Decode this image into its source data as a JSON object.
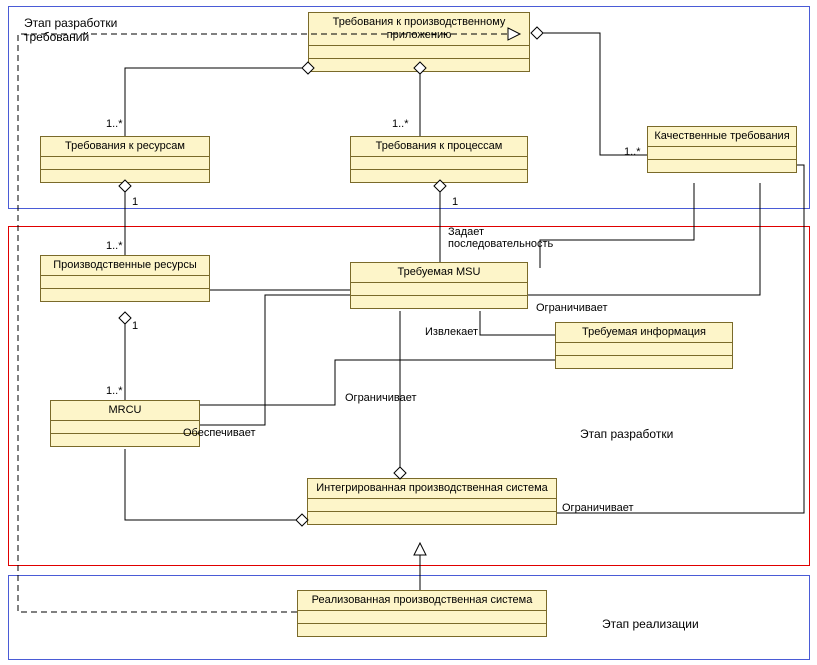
{
  "stages": {
    "requirements": {
      "label": "Этап разработки\nтребований"
    },
    "design": {
      "label": "Этап разработки"
    },
    "impl": {
      "label": "Этап реализации"
    }
  },
  "classes": {
    "appReq": {
      "title": "Требования к производственному\nприложению"
    },
    "resReq": {
      "title": "Требования к ресурсам"
    },
    "procReq": {
      "title": "Требования к процессам"
    },
    "qualReq": {
      "title": "Качественные\nтребования"
    },
    "prodRes": {
      "title": "Производственные\nресурсы"
    },
    "reqMSU": {
      "title": "Требуемая MSU"
    },
    "reqInfo": {
      "title": "Требуемая информация"
    },
    "mrcu": {
      "title": "MRCU"
    },
    "intSys": {
      "title": "Интегрированная производственная\nсистема"
    },
    "realSys": {
      "title": "Реализованная производственная\nсистема"
    }
  },
  "edges": {
    "m_resReq": "1..*",
    "m_procReq": "1..*",
    "m_qualReq": "1..*",
    "m_prodRes_top": "1",
    "m_prodRes_mid": "1..*",
    "m_procReq_bot": "1",
    "m_mrcu_top": "1",
    "m_mrcu_mid": "1..*",
    "seq": "Задает\nпоследовательность",
    "constrain1": "Ограничивает",
    "constrain2": "Ограничивает",
    "constrain3": "Ограничивает",
    "extract": "Извлекает",
    "provide": "Обеспечивает"
  },
  "chart_data": {
    "type": "uml-class-diagram",
    "packages": [
      {
        "id": "requirements",
        "label": "Этап разработки требований",
        "members": [
          "appReq",
          "resReq",
          "procReq",
          "qualReq"
        ]
      },
      {
        "id": "design",
        "label": "Этап разработки",
        "members": [
          "prodRes",
          "reqMSU",
          "reqInfo",
          "mrcu",
          "intSys"
        ]
      },
      {
        "id": "impl",
        "label": "Этап реализации",
        "members": [
          "realSys"
        ]
      }
    ],
    "classes": [
      {
        "id": "appReq",
        "name": "Требования к производственному приложению"
      },
      {
        "id": "resReq",
        "name": "Требования к ресурсам"
      },
      {
        "id": "procReq",
        "name": "Требования к процессам"
      },
      {
        "id": "qualReq",
        "name": "Качественные требования"
      },
      {
        "id": "prodRes",
        "name": "Производственные ресурсы"
      },
      {
        "id": "reqMSU",
        "name": "Требуемая MSU"
      },
      {
        "id": "reqInfo",
        "name": "Требуемая информация"
      },
      {
        "id": "mrcu",
        "name": "MRCU"
      },
      {
        "id": "intSys",
        "name": "Интегрированная производственная система"
      },
      {
        "id": "realSys",
        "name": "Реализованная производственная система"
      }
    ],
    "relations": [
      {
        "type": "aggregation",
        "whole": "appReq",
        "part": "resReq",
        "mult_part": "1..*"
      },
      {
        "type": "aggregation",
        "whole": "appReq",
        "part": "procReq",
        "mult_part": "1..*"
      },
      {
        "type": "aggregation",
        "whole": "appReq",
        "part": "qualReq",
        "mult_part": "1..*"
      },
      {
        "type": "aggregation",
        "whole": "resReq",
        "part": "prodRes",
        "mult_whole": "1",
        "mult_part": "1..*"
      },
      {
        "type": "aggregation",
        "whole": "procReq",
        "part": "reqMSU",
        "mult_whole": "1"
      },
      {
        "type": "aggregation",
        "whole": "prodRes",
        "part": "mrcu",
        "mult_whole": "1",
        "mult_part": "1..*"
      },
      {
        "type": "aggregation",
        "whole": "intSys",
        "part": "mrcu"
      },
      {
        "type": "aggregation",
        "whole": "intSys",
        "part": "reqMSU"
      },
      {
        "type": "association",
        "from": "qualReq",
        "to": "reqMSU",
        "label": "Задает последовательность"
      },
      {
        "type": "association",
        "from": "qualReq",
        "to": "reqMSU",
        "label": "Ограничивает"
      },
      {
        "type": "association",
        "from": "reqInfo",
        "to": "reqMSU",
        "label": "Извлекает"
      },
      {
        "type": "association",
        "from": "reqInfo",
        "to": "mrcu",
        "label": "Ограничивает"
      },
      {
        "type": "association",
        "from": "qualReq",
        "to": "intSys",
        "label": "Ограничивает"
      },
      {
        "type": "association",
        "from": "mrcu",
        "to": "reqMSU",
        "label": "Обеспечивает"
      },
      {
        "type": "generalization",
        "child": "realSys",
        "parent": "intSys"
      },
      {
        "type": "realization",
        "from": "realSys",
        "to": "appReq"
      }
    ]
  }
}
